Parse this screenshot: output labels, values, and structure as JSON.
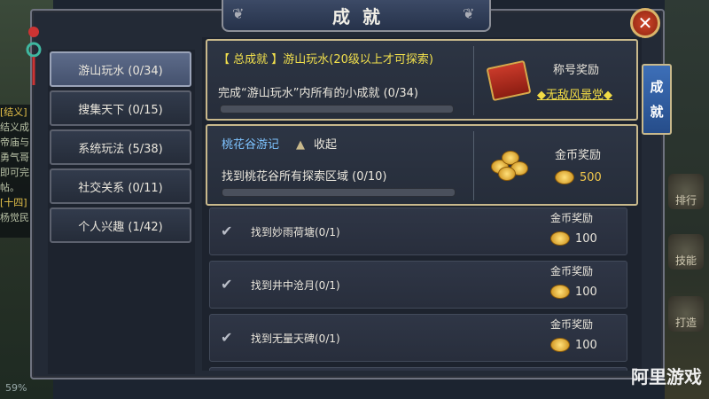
{
  "window": {
    "title": "成就",
    "close_label": "✕"
  },
  "side_tab": {
    "label_top": "成",
    "label_bottom": "就"
  },
  "categories": [
    {
      "label": "游山玩水 (0/34)",
      "active": true
    },
    {
      "label": "搜集天下 (0/15)",
      "active": false
    },
    {
      "label": "系统玩法 (5/38)",
      "active": false
    },
    {
      "label": "社交关系 (0/11)",
      "active": false
    },
    {
      "label": "个人兴趣 (1/42)",
      "active": false
    }
  ],
  "summary_card": {
    "title": "【 总成就 】游山玩水(20级以上才可探索)",
    "desc": "完成“游山玩水”内所有的小成就 (0/34)",
    "progress": 0,
    "reward_title": "称号奖励",
    "reward_name": "◆无敌风景党◆"
  },
  "group_card": {
    "title": "桃花谷游记",
    "toggle_label": "收起",
    "desc": "找到桃花谷所有探索区域 (0/10)",
    "progress": 0,
    "reward_title": "金币奖励",
    "reward_value": "500"
  },
  "rows": [
    {
      "name": "找到妙雨荷塘(0/1)",
      "reward_title": "金币奖励",
      "reward_value": "100"
    },
    {
      "name": "找到井中沧月(0/1)",
      "reward_title": "金币奖励",
      "reward_value": "100"
    },
    {
      "name": "找到无量天碑(0/1)",
      "reward_title": "金币奖励",
      "reward_value": "100"
    }
  ],
  "hud": {
    "right_buttons": [
      "排行",
      "技能",
      "打造"
    ],
    "chat_lines": [
      "[结义]",
      "结义成",
      "帝庙与",
      "勇气哥",
      "即可完",
      "帖。",
      "[十四]",
      "杨觉民"
    ],
    "battery": "59%",
    "watermark": "阿里游戏"
  },
  "colors": {
    "accent_gold": "#c9b98c",
    "highlight_yellow": "#f2e04c",
    "link_blue": "#7ec3ff",
    "active_tab": "#5d6b8a"
  }
}
